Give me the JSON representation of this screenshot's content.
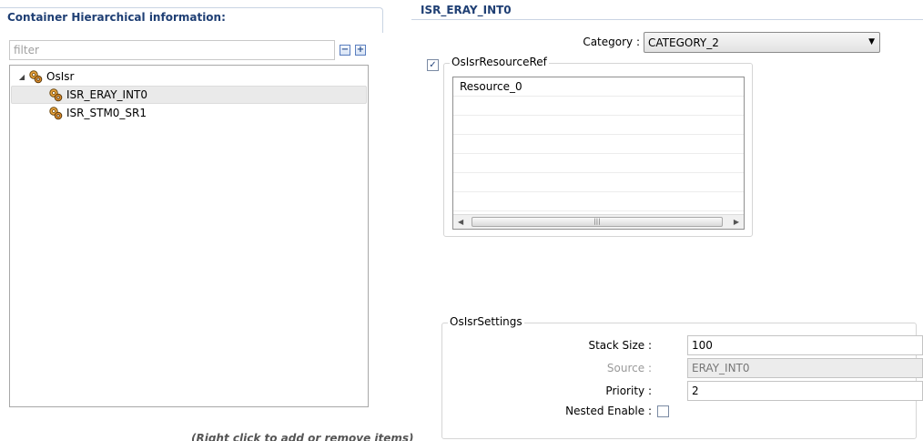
{
  "left": {
    "title": "Container Hierarchical information:",
    "filter_placeholder": "filter",
    "collapse_glyph": "−",
    "expand_glyph": "+",
    "tree": {
      "root": {
        "label": "OsIsr",
        "expanded": true
      },
      "children": [
        {
          "label": "ISR_ERAY_INT0",
          "selected": true
        },
        {
          "label": "ISR_STM0_SR1",
          "selected": false
        }
      ]
    },
    "hint": "(Right click to add or remove items)"
  },
  "right": {
    "title": "ISR_ERAY_INT0",
    "category": {
      "label": "Category :",
      "value": "CATEGORY_2"
    },
    "resource_ref": {
      "enabled": true,
      "check_glyph": "✓",
      "legend": "OsIsrResourceRef",
      "items": [
        "Resource_0"
      ]
    },
    "settings": {
      "legend": "OsIsrSettings",
      "stack_size": {
        "label": "Stack Size :",
        "value": "100"
      },
      "source": {
        "label": "Source :",
        "value": "ERAY_INT0"
      },
      "priority": {
        "label": "Priority :",
        "value": "2"
      },
      "nested_enable": {
        "label": "Nested Enable :",
        "checked": false
      }
    }
  },
  "colors": {
    "section_title": "#1f3f74",
    "tree_border": "#a8a8a8",
    "selection": "#eaeaea"
  }
}
